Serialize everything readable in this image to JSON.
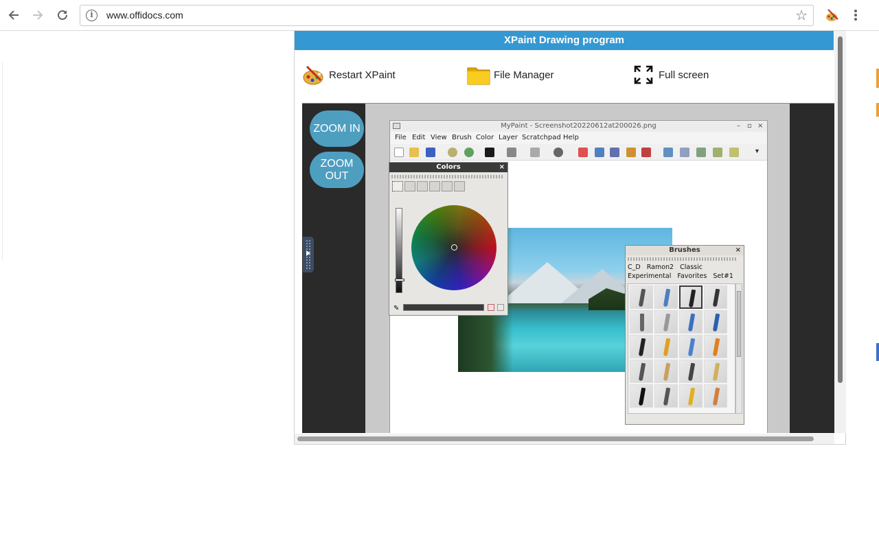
{
  "browser": {
    "url": "www.offidocs.com",
    "back_icon": "back-arrow-icon",
    "forward_icon": "forward-arrow-icon",
    "reload_icon": "reload-icon",
    "info_glyph": "i",
    "star_glyph": "☆"
  },
  "app": {
    "title": "XPaint Drawing program",
    "toolbar": {
      "restart_label": "Restart XPaint",
      "file_manager_label": "File Manager",
      "fullscreen_label": "Full screen"
    },
    "zoom_in_label": "ZOOM IN",
    "zoom_out_label": "ZOOM OUT",
    "accent_color": "#3498d2",
    "zoom_button_color": "#4e9ec0"
  },
  "mypaint": {
    "window_title": "MyPaint - Screenshot20220612at200026.png",
    "window_controls": [
      "–",
      "▫",
      "×"
    ],
    "menus": [
      "File",
      "Edit",
      "View",
      "Brush",
      "Color",
      "Layer",
      "Scratchpad",
      "Help"
    ],
    "colors_panel": {
      "title": "Colors",
      "close": "×",
      "selected_color": "#2a2a2a"
    },
    "brushes_panel": {
      "title": "Brushes",
      "close": "×",
      "groups_row1": [
        "C_D",
        "Ramon2",
        "Classic"
      ],
      "groups_row2": [
        "Experimental",
        "Favorites",
        "Set#1"
      ]
    }
  }
}
